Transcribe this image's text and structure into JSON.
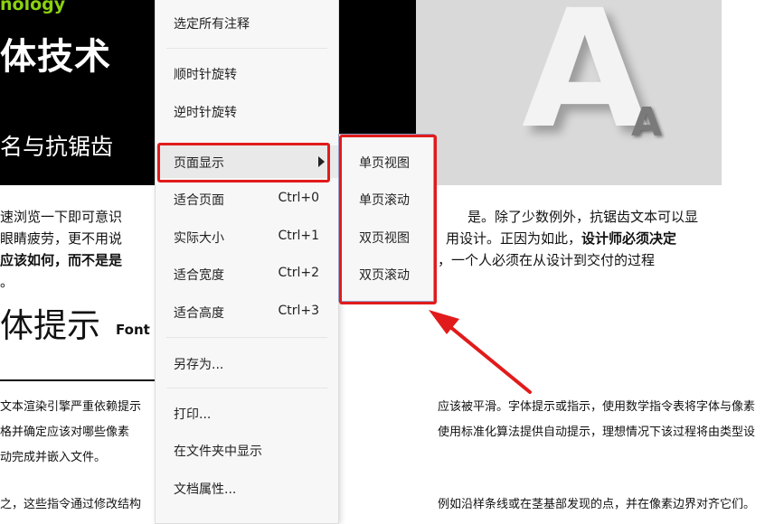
{
  "document": {
    "banner_tech": "nology",
    "banner_title": "体技术",
    "banner_subtitle": "名与抗锯齿",
    "photo_big_letter": "A",
    "photo_small_letter": "A",
    "para1_line1a": "速浏览一下即可意识",
    "para1_line1b": "是。除了少数例外，抗锯齿文本可以显",
    "para1_line2a": "眼睛疲劳，更不用说",
    "para1_line2b": "用设计。正因为如此，",
    "para1_line2c": "设计师必须决定",
    "para1_line3a": "应该如何，而不是是",
    "para1_line3b": "，一个人必须在从设计到交付的过程",
    "para1_line4": "。",
    "heading2": "体提示",
    "heading2_sub": "Font",
    "small_line1a": "文本渲染引擎严重依赖提示",
    "small_line1b": "应该被平滑。字体提示或指示，使用数学指令表将字体与像素",
    "small_line2a": "格并确定应该对哪些像素",
    "small_line2b": "使用标准化算法提供自动提示，理想情况下该过程将由类型设",
    "small_line3": "动完成并嵌入文件。",
    "small_line4a": "之，这些指令通过修改结构",
    "small_line4b": "例如沿样条线或在茎基部发现的点，并在像素边界对齐它们。"
  },
  "context_menu": {
    "items": [
      {
        "label": "选定所有注释",
        "shortcut": ""
      },
      {
        "label": "顺时针旋转",
        "shortcut": ""
      },
      {
        "label": "逆时针旋转",
        "shortcut": ""
      },
      {
        "label": "页面显示",
        "shortcut": ""
      },
      {
        "label": "适合页面",
        "shortcut": "Ctrl+0"
      },
      {
        "label": "实际大小",
        "shortcut": "Ctrl+1"
      },
      {
        "label": "适合宽度",
        "shortcut": "Ctrl+2"
      },
      {
        "label": "适合高度",
        "shortcut": "Ctrl+3"
      },
      {
        "label": "另存为...",
        "shortcut": ""
      },
      {
        "label": "打印...",
        "shortcut": ""
      },
      {
        "label": "在文件夹中显示",
        "shortcut": ""
      },
      {
        "label": "文档属性...",
        "shortcut": ""
      }
    ]
  },
  "submenu": {
    "items": [
      {
        "label": "单页视图"
      },
      {
        "label": "单页滚动"
      },
      {
        "label": "双页视图"
      },
      {
        "label": "双页滚动"
      }
    ]
  },
  "colors": {
    "annotation_red": "#e11b1b",
    "banner_green": "#8bd10f"
  }
}
